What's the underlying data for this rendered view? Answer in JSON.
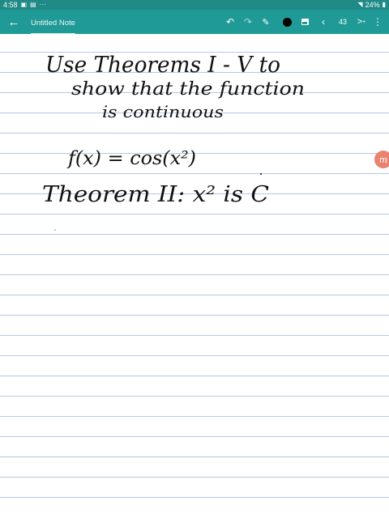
{
  "status_bar": {
    "time": "4:58",
    "battery": "24%",
    "background": "#1f8a86"
  },
  "toolbar": {
    "title": "Untitled Note",
    "page_number": "43",
    "background": "#209a96",
    "pen_color": "#000000",
    "icons": [
      "back-arrow-icon",
      "undo-icon",
      "redo-icon",
      "pen-icon",
      "color-swatch-icon",
      "image-icon",
      "previous-page-icon",
      "next-page-icon",
      "more-icon"
    ]
  },
  "note": {
    "line_color": "#b7c6ea",
    "handwriting": {
      "line1": "Use Theorems I - V to",
      "line2": "show that the function",
      "line3": "is continuous",
      "line4": "f(x) = cos(x²)",
      "line5": "Theorem II: x² is C"
    }
  },
  "floating_button": {
    "label": "m",
    "color": "#e9836f"
  }
}
